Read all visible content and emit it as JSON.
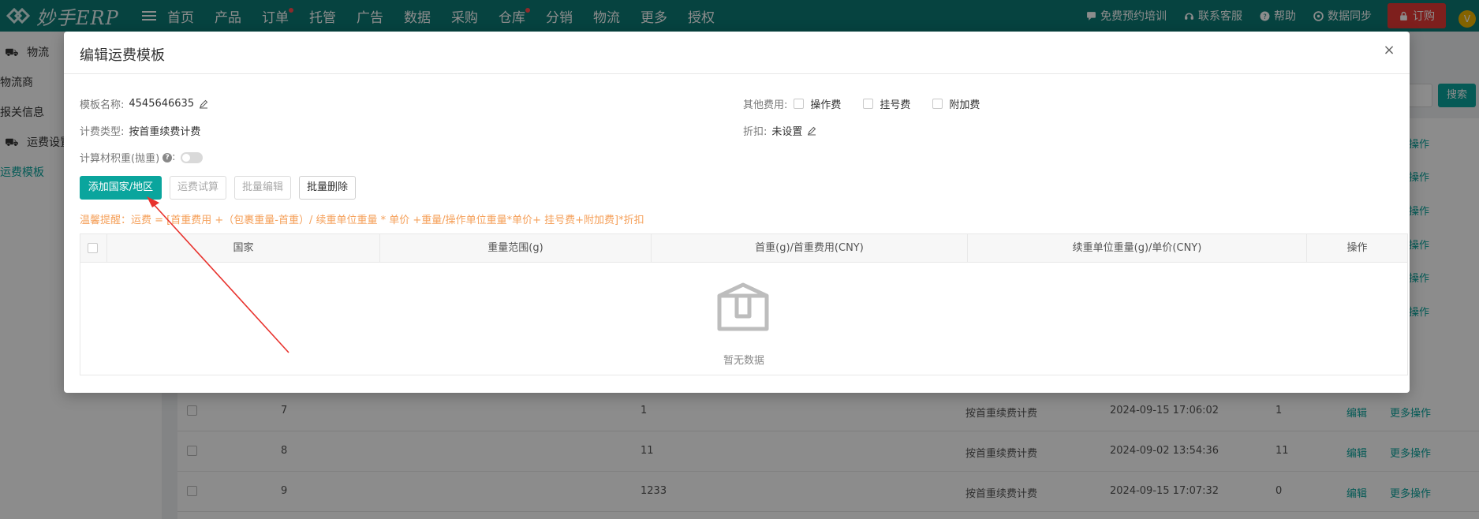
{
  "brand": {
    "name": "妙手ERP"
  },
  "nav": {
    "items": [
      {
        "label": "首页",
        "dot": false
      },
      {
        "label": "产品",
        "dot": false
      },
      {
        "label": "订单",
        "dot": true
      },
      {
        "label": "托管",
        "dot": false
      },
      {
        "label": "广告",
        "dot": false
      },
      {
        "label": "数据",
        "dot": false
      },
      {
        "label": "采购",
        "dot": false
      },
      {
        "label": "仓库",
        "dot": true
      },
      {
        "label": "分销",
        "dot": false
      },
      {
        "label": "物流",
        "dot": false
      },
      {
        "label": "更多",
        "dot": false
      },
      {
        "label": "授权",
        "dot": false
      }
    ]
  },
  "top_right": {
    "training": "免费预约培训",
    "support": "联系客服",
    "help": "帮助",
    "sync": "数据同步",
    "order": "订购",
    "avatar": "V"
  },
  "sidebar": {
    "logistics": "物流",
    "carrier": "物流商",
    "customs": "报关信息",
    "freight_settings": "运费设置",
    "freight_template": "运费模板"
  },
  "background": {
    "search_label": "搜索",
    "rows": [
      {
        "no": "7",
        "name": "1",
        "type": "按首重续费计费",
        "time": "2024-09-15 17:06:02",
        "count": "1",
        "edit": "编辑",
        "more": "更多操作"
      },
      {
        "no": "8",
        "name": "11",
        "type": "按首重续费计费",
        "time": "2024-09-02 13:54:36",
        "count": "11",
        "edit": "编辑",
        "more": "更多操作"
      },
      {
        "no": "9",
        "name": "1233",
        "type": "按首重续费计费",
        "time": "2024-09-15 17:07:32",
        "count": "0",
        "edit": "编辑",
        "more": "更多操作"
      }
    ],
    "more_label": "更多操作"
  },
  "modal": {
    "title": "编辑运费模板",
    "close": "×",
    "template_name_label": "模板名称:",
    "template_name_value": "4545646635",
    "billing_type_label": "计费类型:",
    "billing_type_value": "按首重续费计费",
    "volume_weight_label": "计算材积重(抛重)",
    "volume_weight_suffix": ":",
    "other_fees_label": "其他费用:",
    "other_fees": [
      "操作费",
      "挂号费",
      "附加费"
    ],
    "discount_label": "折扣:",
    "discount_value": "未设置",
    "buttons": {
      "add_country": "添加国家/地区",
      "freight_trial": "运费试算",
      "batch_edit": "批量编辑",
      "batch_delete": "批量删除"
    },
    "tip": "温馨提醒：运费 = [首重费用 +（包裹重量-首重）/ 续重单位重量 * 单价 +重量/操作单位重量*单价+ 挂号费+附加费]*折扣",
    "table": {
      "columns": [
        "国家",
        "重量范围(g)",
        "首重(g)/首重费用(CNY)",
        "续重单位重量(g)/单价(CNY)",
        "操作"
      ],
      "empty_text": "暂无数据"
    }
  },
  "colors": {
    "primary": "#0aa59d",
    "topbar": "#0b7a75",
    "order": "#e53935",
    "tip": "#f5a05a",
    "arrow": "#e8322d"
  }
}
